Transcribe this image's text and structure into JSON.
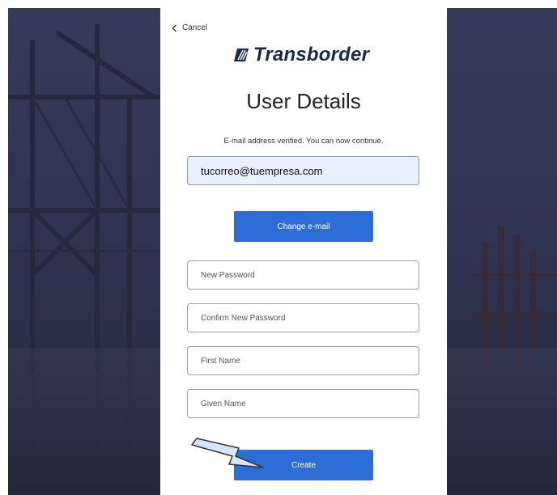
{
  "header": {
    "cancel_label": "Cancel",
    "brand_name": "Transborder"
  },
  "page": {
    "title": "User Details",
    "verified_message": "E-mail address verified. You can now continue."
  },
  "form": {
    "email_value": "tucorreo@tuempresa.com",
    "change_email_label": "Change e-mail",
    "new_password_placeholder": "New Password",
    "confirm_password_placeholder": "Confirm New Password",
    "first_name_placeholder": "First Name",
    "given_name_placeholder": "Given Name",
    "create_label": "Create"
  },
  "colors": {
    "accent": "#2d6ed6",
    "brand": "#1a2b48",
    "email_fill": "#e8f0fe"
  }
}
